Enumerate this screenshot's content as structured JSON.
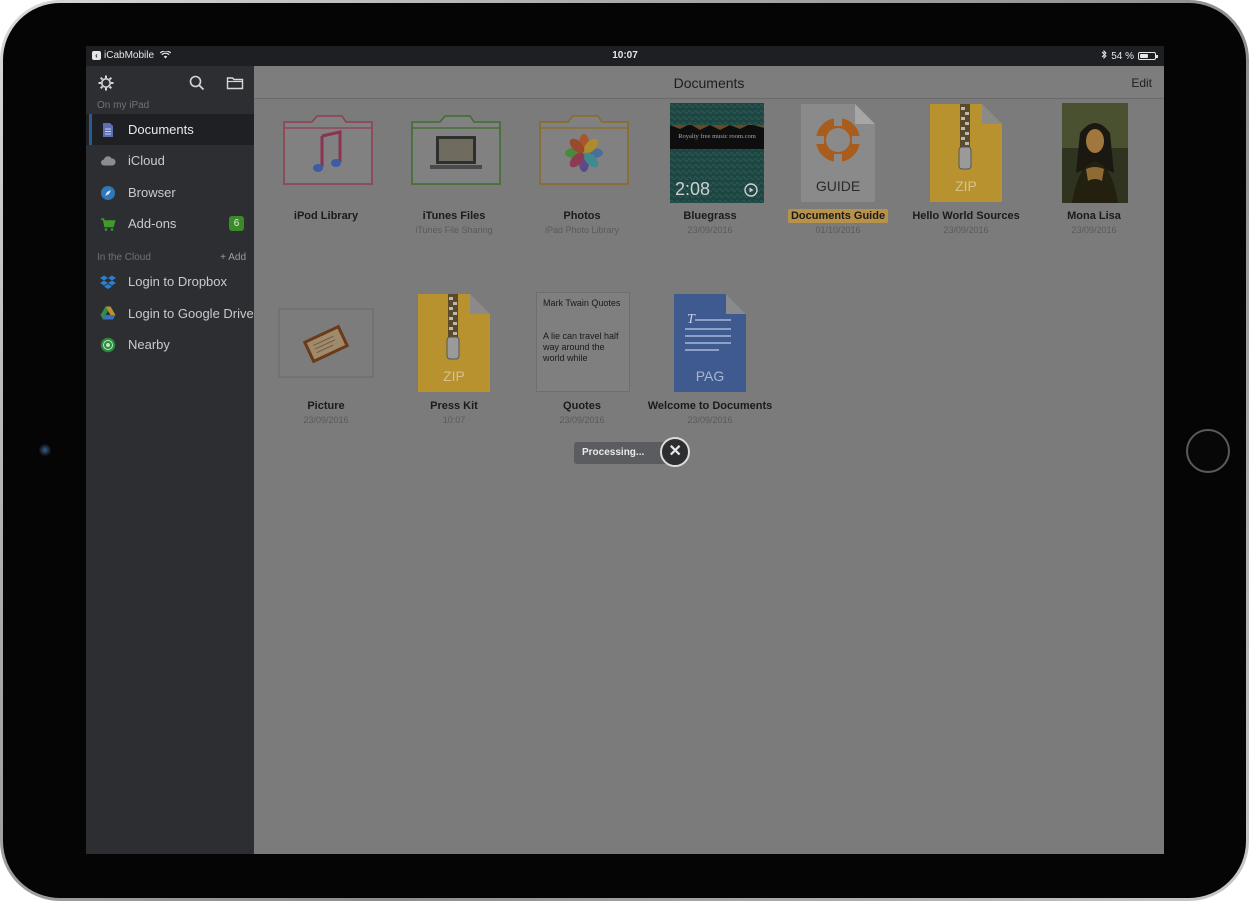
{
  "status_bar": {
    "carrier": "iCabMobile",
    "time": "10:07",
    "battery_text": "54 %",
    "battery_level": 0.54
  },
  "sidebar": {
    "toolbar_icons": [
      "gear-icon",
      "search-icon",
      "folder-icon"
    ],
    "section_on_ipad": "On my iPad",
    "items_on_ipad": [
      {
        "label": "Documents",
        "icon": "documents-icon",
        "active": true
      },
      {
        "label": "iCloud",
        "icon": "cloud-icon"
      },
      {
        "label": "Browser",
        "icon": "compass-icon"
      },
      {
        "label": "Add-ons",
        "icon": "cart-icon",
        "badge": "6"
      }
    ],
    "section_cloud": "In the Cloud",
    "section_cloud_action": "+ Add",
    "items_cloud": [
      {
        "label": "Login to Dropbox",
        "icon": "dropbox-icon"
      },
      {
        "label": "Login to Google Drive",
        "icon": "google-drive-icon"
      },
      {
        "label": "Nearby",
        "icon": "nearby-icon"
      }
    ]
  },
  "main": {
    "title": "Documents",
    "edit_label": "Edit",
    "files": [
      {
        "name": "iPod Library",
        "sub": "",
        "kind": "music-folder"
      },
      {
        "name": "iTunes Files",
        "sub": "iTunes File Sharing",
        "kind": "laptop-folder"
      },
      {
        "name": "Photos",
        "sub": "iPad Photo Library",
        "kind": "photos-folder"
      },
      {
        "name": "Bluegrass",
        "sub": "23/09/2016",
        "kind": "video",
        "duration": "2:08",
        "overlay_text": "Royalty free music room.com"
      },
      {
        "name": "Documents Guide",
        "sub": "01/10/2016",
        "kind": "guide",
        "icon_label": "GUIDE",
        "highlighted": true
      },
      {
        "name": "Hello World Sources",
        "sub": "23/09/2016",
        "kind": "zip",
        "icon_label": "ZIP"
      },
      {
        "name": "Mona Lisa",
        "sub": "23/09/2016",
        "kind": "image"
      },
      {
        "name": "Picture",
        "sub": "23/09/2016",
        "kind": "picture"
      },
      {
        "name": "Press Kit",
        "sub": "10:07",
        "kind": "zip",
        "icon_label": "ZIP"
      },
      {
        "name": "Quotes",
        "sub": "23/09/2016",
        "kind": "text",
        "preview_title": "Mark Twain Quotes",
        "preview_body": "A lie can travel half way around the world while"
      },
      {
        "name": "Welcome to Documents",
        "sub": "23/09/2016",
        "kind": "pages",
        "icon_label": "PAG"
      }
    ]
  },
  "overlay": {
    "processing_label": "Processing...",
    "close_icon": "close-icon"
  },
  "colors": {
    "sidebar_bg": "#2c2e32",
    "main_dimmed_bg": "#7b7b7c",
    "badge_green": "#3b8a2a",
    "zip_gold": "#b8922e",
    "pages_blue": "#3f5a8f",
    "guide_orange": "#a95d1c"
  }
}
